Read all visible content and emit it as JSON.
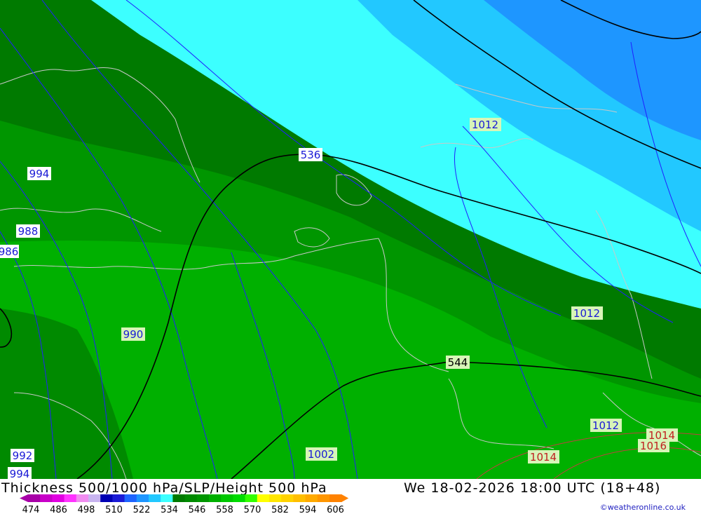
{
  "map": {
    "isobar_labels": [
      {
        "text": "1012",
        "color": "#1a1ad6",
        "fill": "#d8f5b8"
      },
      {
        "text": "536",
        "color": "#1a1ad6",
        "fill": "#ffffff"
      },
      {
        "text": "994",
        "color": "#1a1ad6",
        "fill": "#ffffff"
      },
      {
        "text": "988",
        "color": "#1a1ad6",
        "fill": "#ffffff"
      },
      {
        "text": "986",
        "color": "#1a1ad6",
        "fill": "#ffffff"
      },
      {
        "text": "990",
        "color": "#1a1ad6",
        "fill": "#d8f5b8"
      },
      {
        "text": "1012",
        "color": "#1a1ad6",
        "fill": "#d8f5b8"
      },
      {
        "text": "544",
        "color": "#000000",
        "fill": "#d8f5b8"
      },
      {
        "text": "1012",
        "color": "#1a1ad6",
        "fill": "#d8f5b8"
      },
      {
        "text": "1014",
        "color": "#c02020",
        "fill": "#d8f5b8"
      },
      {
        "text": "1016",
        "color": "#c02020",
        "fill": "#d8f5b8"
      },
      {
        "text": "1014",
        "color": "#c02020",
        "fill": "#d8f5b8"
      },
      {
        "text": "1002",
        "color": "#1a1ad6",
        "fill": "#d8f5b8"
      },
      {
        "text": "992",
        "color": "#1a1ad6",
        "fill": "#ffffff"
      },
      {
        "text": "994",
        "color": "#1a1ad6",
        "fill": "#ffffff"
      }
    ],
    "colors": {
      "dark_green": "#007a00",
      "mid_green": "#009600",
      "bright_green": "#00b000",
      "cyan": "#3cffff",
      "light_blue": "#22c8ff",
      "blue": "#1e96ff",
      "isobar": "#2020ff",
      "contour": "#000000",
      "coast": "#c8c8c8"
    }
  },
  "footer": {
    "title_left": "Thickness 500/1000 hPa/SLP/Height 500 hPa",
    "title_right": "We 18-02-2026 18:00 UTC (18+48)",
    "credit": "©weatheronline.co.uk",
    "legend": {
      "ticks": [
        "474",
        "486",
        "498",
        "510",
        "522",
        "534",
        "546",
        "558",
        "570",
        "582",
        "594",
        "606"
      ],
      "swatches": [
        "#a800a8",
        "#c800c8",
        "#e100e1",
        "#ff32ff",
        "#f08cf0",
        "#c8b4f0",
        "#0000b4",
        "#1a1ad6",
        "#1e64ff",
        "#1e96ff",
        "#22c8ff",
        "#3cffff",
        "#007a00",
        "#008a00",
        "#009600",
        "#00b000",
        "#00c800",
        "#00dc00",
        "#32ff00",
        "#ffff00",
        "#ffe600",
        "#ffd200",
        "#ffbe00",
        "#ffaa00",
        "#ff9600",
        "#ff8200"
      ]
    }
  }
}
